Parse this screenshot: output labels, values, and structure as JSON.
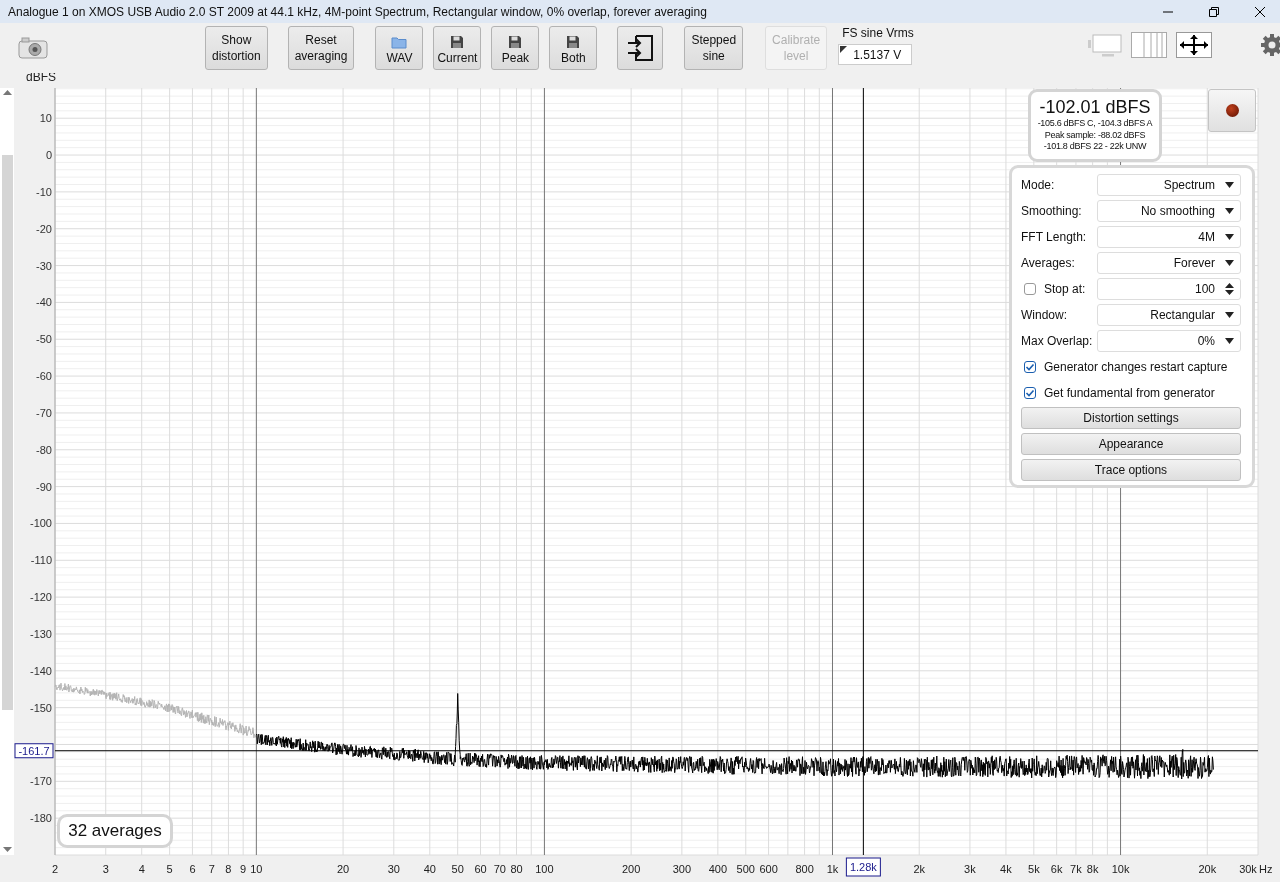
{
  "window": {
    "title": "Analogue 1 on XMOS USB Audio 2.0 ST 2009 at 44.1 kHz, 4M-point Spectrum, Rectangular window, 0% overlap, forever averaging"
  },
  "toolbar": {
    "buttons": [
      {
        "label": "Show distortion",
        "kind": "text",
        "disabled": false
      },
      {
        "label": "Reset averaging",
        "kind": "text",
        "disabled": false
      },
      {
        "label": "WAV",
        "kind": "folder",
        "disabled": false
      },
      {
        "label": "Current",
        "kind": "save",
        "disabled": false
      },
      {
        "label": "Peak",
        "kind": "save",
        "disabled": false
      },
      {
        "label": "Both",
        "kind": "save",
        "disabled": false
      },
      {
        "kind": "import",
        "disabled": false
      },
      {
        "label": "Stepped sine",
        "kind": "text",
        "disabled": false
      },
      {
        "label": "Calibrate level",
        "kind": "text",
        "disabled": true
      }
    ],
    "fs_field": {
      "label": "FS sine Vrms",
      "value": "1.5137 V"
    }
  },
  "readout": {
    "main": "-102.01 dBFS",
    "lines": [
      "-105.6 dBFS C, -104.3 dBFS A",
      "Peak sample: -88.02 dBFS",
      "-101.8 dBFS 22 - 22k UNW"
    ]
  },
  "settings": {
    "controls": [
      {
        "kind": "select",
        "label": "Mode:",
        "value": "Spectrum"
      },
      {
        "kind": "select",
        "label": "Smoothing:",
        "value": "No smoothing"
      },
      {
        "kind": "select",
        "label": "FFT Length:",
        "value": "4M"
      },
      {
        "kind": "select",
        "label": "Averages:",
        "value": "Forever"
      },
      {
        "kind": "spin",
        "label": "Stop at:",
        "value": "100",
        "checked": false
      },
      {
        "kind": "select",
        "label": "Window:",
        "value": "Rectangular"
      },
      {
        "kind": "select",
        "label": "Max Overlap:",
        "value": "0%"
      },
      {
        "kind": "check",
        "label": "Generator changes restart capture",
        "checked": true
      },
      {
        "kind": "check",
        "label": "Get fundamental from generator",
        "checked": true
      },
      {
        "kind": "button",
        "label": "Distortion settings"
      },
      {
        "kind": "button",
        "label": "Appearance"
      },
      {
        "kind": "button",
        "label": "Trace options"
      }
    ]
  },
  "averages": "32 averages",
  "chart": {
    "y_unit": "dBFS",
    "x_unit": "Hz",
    "y_labels": [
      "10",
      "0",
      "-10",
      "-20",
      "-30",
      "-40",
      "-50",
      "-60",
      "-70",
      "-80",
      "-90",
      "-100",
      "-110",
      "-120",
      "-130",
      "-140",
      "-150",
      "-170",
      "-180"
    ],
    "x_labels": [
      "2",
      "3",
      "4",
      "5",
      "6",
      "7",
      "8",
      "9",
      "10",
      "20",
      "30",
      "40",
      "50",
      "60",
      "70",
      "80",
      "100",
      "200",
      "300",
      "400",
      "500",
      "600",
      "800",
      "1k",
      "2k",
      "3k",
      "4k",
      "5k",
      "6k",
      "7k",
      "8k",
      "10k",
      "20k",
      "30k"
    ],
    "cursor": {
      "frequency": "1.28k",
      "level": "-161.7"
    }
  }
}
